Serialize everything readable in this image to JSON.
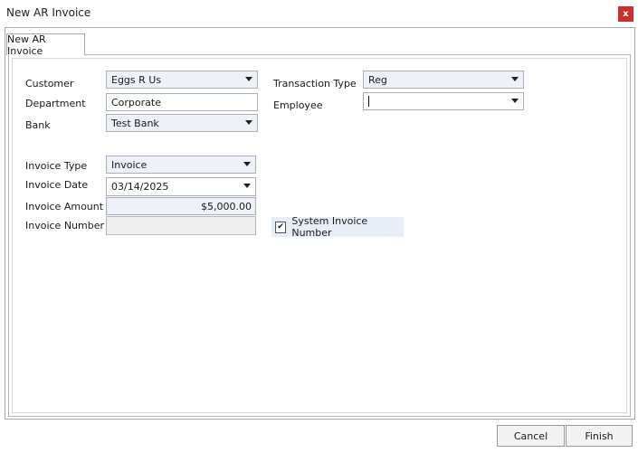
{
  "window": {
    "title": "New AR Invoice",
    "close_label": "x"
  },
  "tab": {
    "label": "New AR Invoice"
  },
  "form": {
    "customer": {
      "label": "Customer",
      "value": "Eggs R Us"
    },
    "department": {
      "label": "Department",
      "value": "Corporate"
    },
    "bank": {
      "label": "Bank",
      "value": "Test Bank"
    },
    "transaction_type": {
      "label": "Transaction Type",
      "value": "Reg"
    },
    "employee": {
      "label": "Employee",
      "value": ""
    },
    "invoice_type": {
      "label": "Invoice Type",
      "value": "Invoice"
    },
    "invoice_date": {
      "label": "Invoice Date",
      "value": "03/14/2025"
    },
    "invoice_amount": {
      "label": "Invoice Amount",
      "value": "$5,000.00"
    },
    "invoice_number": {
      "label": "Invoice Number",
      "value": ""
    },
    "system_invoice_number": {
      "label": "System Invoice Number",
      "checked": true,
      "check_glyph": "✔"
    }
  },
  "buttons": {
    "cancel": "Cancel",
    "finish": "Finish"
  },
  "colors": {
    "field_bg": "#eef1f8",
    "close_bg": "#c9302c",
    "checkbox_bg": "#e8eef8"
  }
}
